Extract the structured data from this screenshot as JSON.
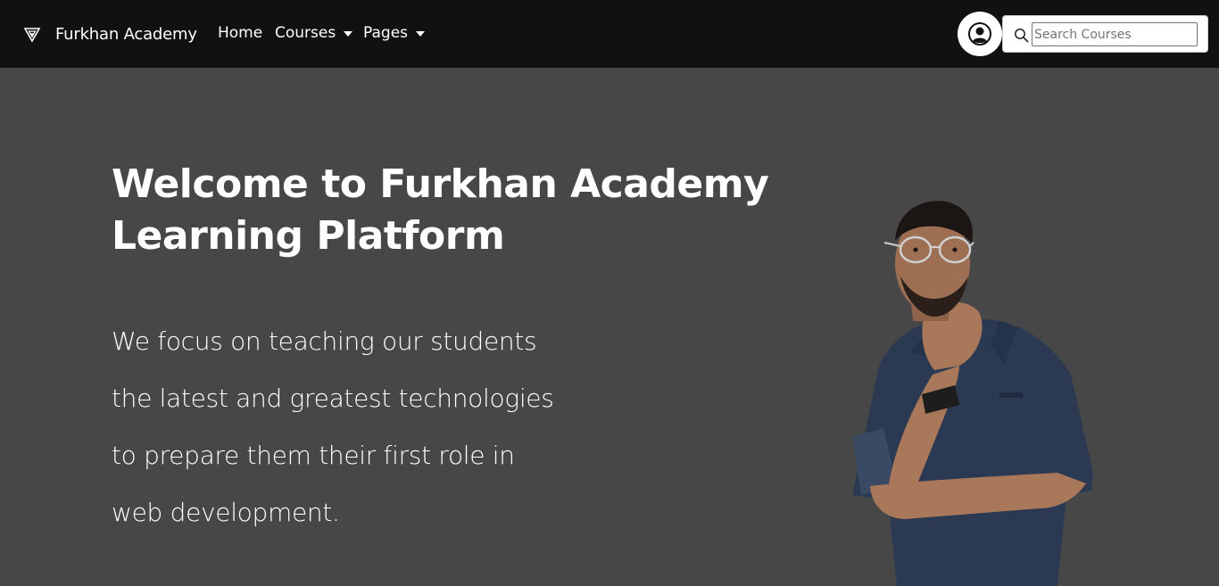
{
  "nav": {
    "brand": "Furkhan Academy",
    "links": [
      {
        "label": "Home"
      },
      {
        "label": "Courses"
      },
      {
        "label": "Pages"
      }
    ],
    "search": {
      "placeholder": "Search Courses",
      "value": ""
    }
  },
  "hero": {
    "title": "Welcome to Furkhan Academy Learning Platform",
    "lines": [
      "We focus on teaching our students",
      "the latest and greatest technologies",
      "to prepare them their first role in",
      "web development."
    ]
  },
  "icons": {
    "brand": "triangle-logo-icon",
    "account": "user-circle-icon",
    "search": "search-icon",
    "dropdown": "caret-down-icon"
  },
  "colors": {
    "navbar": "#111111",
    "background": "#474747",
    "text": "#ffffff"
  }
}
